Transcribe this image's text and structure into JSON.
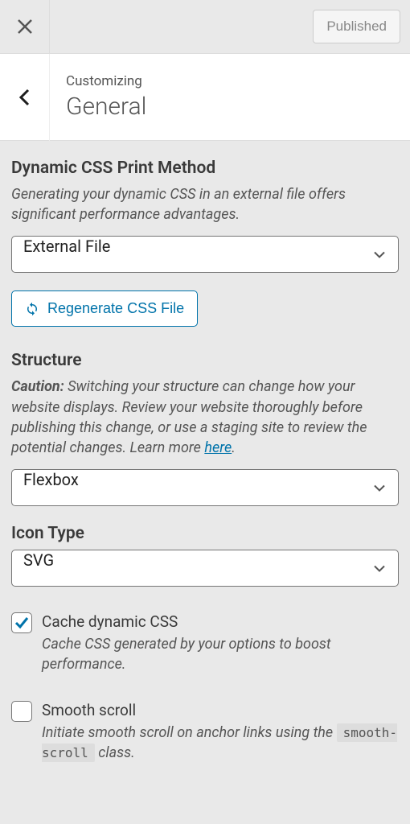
{
  "topbar": {
    "published_label": "Published"
  },
  "header": {
    "subtitle": "Customizing",
    "title": "General"
  },
  "css_method": {
    "heading": "Dynamic CSS Print Method",
    "description": "Generating your dynamic CSS in an external file offers significant performance advantages.",
    "selected": "External File",
    "regenerate_label": "Regenerate CSS File"
  },
  "structure": {
    "heading": "Structure",
    "caution_label": "Caution:",
    "description": " Switching your structure can change how your website displays. Review your website thoroughly before publishing this change, or use a staging site to review the potential changes. Learn more ",
    "link_text": "here",
    "after_link": ".",
    "selected": "Flexbox"
  },
  "icon_type": {
    "heading": "Icon Type",
    "selected": "SVG"
  },
  "cache_css": {
    "label": "Cache dynamic CSS",
    "description": "Cache CSS generated by your options to boost performance.",
    "checked": true
  },
  "smooth_scroll": {
    "label": "Smooth scroll",
    "description_before": "Initiate smooth scroll on anchor links using the ",
    "code": "smooth-scroll",
    "description_after": " class.",
    "checked": false
  }
}
